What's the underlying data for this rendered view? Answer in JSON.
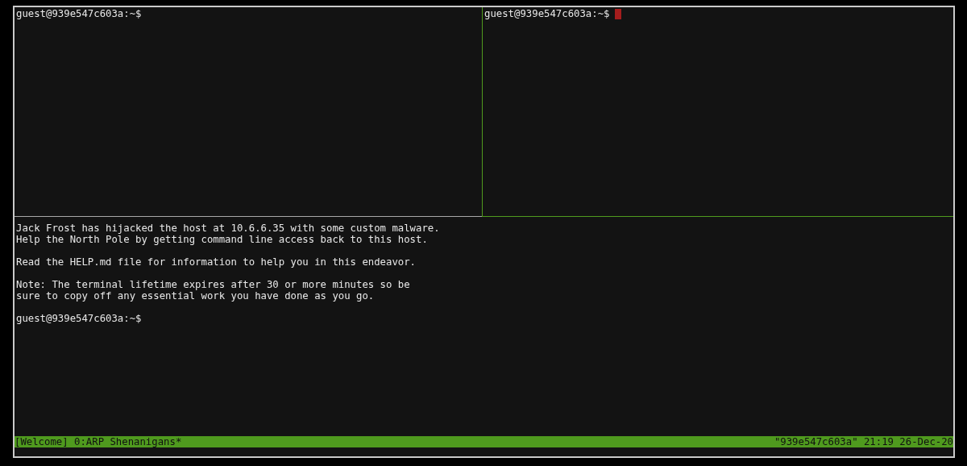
{
  "top_panes": [
    {
      "active": false,
      "prompt": "guest@939e547c603a:~$",
      "cursor": false
    },
    {
      "active": true,
      "prompt": "guest@939e547c603a:~$",
      "cursor": true
    }
  ],
  "bottom_pane": {
    "active": false,
    "output": [
      "Jack Frost has hijacked the host at 10.6.6.35 with some custom malware.\nHelp the North Pole by getting command line access back to this host.",
      "Read the HELP.md file for information to help you in this endeavor.",
      "Note: The terminal lifetime expires after 30 or more minutes so be\nsure to copy off any essential work you have done as you go."
    ],
    "prompt": "guest@939e547c603a:~$",
    "cursor": false
  },
  "status_bar": {
    "left": "[Welcome] 0:ARP Shenanigans*",
    "right": "\"939e547c603a\" 21:19 26-Dec-20"
  }
}
